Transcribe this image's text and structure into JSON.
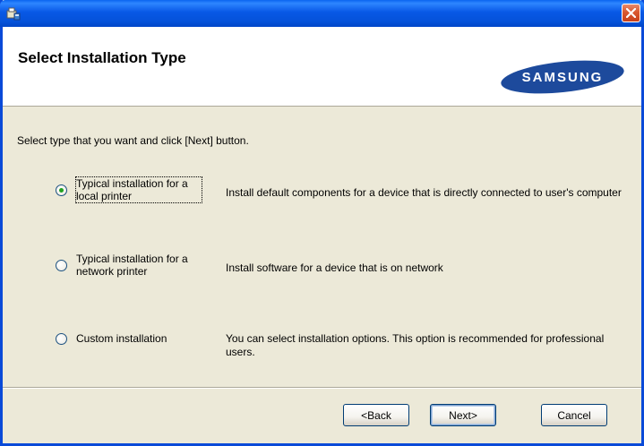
{
  "window": {
    "title": "",
    "colors": {
      "titlebar": "#0552d9",
      "close": "#d9582f",
      "dialog_bg": "#ece9d8",
      "header_bg": "#ffffff",
      "logo": "#1d4a9c",
      "radio_dot": "#21a121"
    }
  },
  "header": {
    "title": "Select Installation Type",
    "logo_text": "SAMSUNG"
  },
  "body": {
    "instructions": "Select type that you want and click [Next] button.",
    "options": [
      {
        "label": "Typical installation for a local printer",
        "description": "Install default components for a device that is directly connected to user's computer",
        "selected": true
      },
      {
        "label": "Typical installation for a network printer",
        "description": "Install software for a device that is on network",
        "selected": false
      },
      {
        "label": "Custom installation",
        "description": "You can select installation options. This option is recommended for professional users.",
        "selected": false
      }
    ]
  },
  "footer": {
    "back_label": "<Back",
    "next_label": "Next>",
    "cancel_label": "Cancel"
  }
}
